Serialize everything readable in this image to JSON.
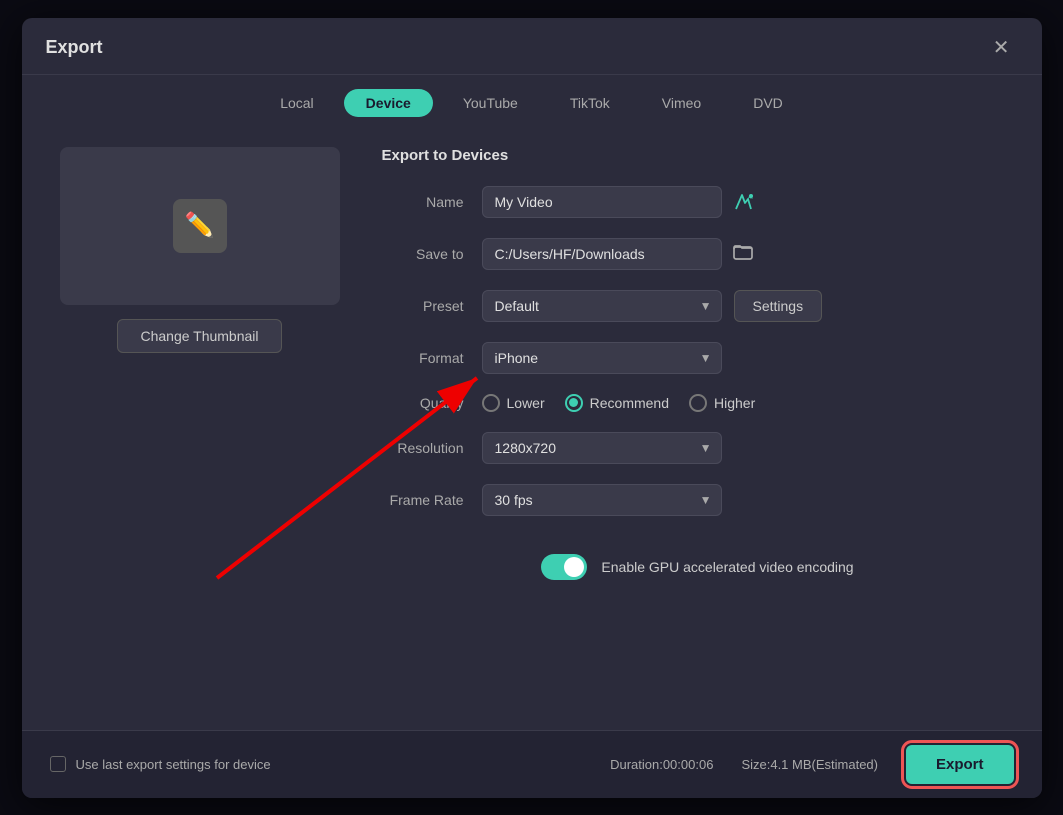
{
  "dialog": {
    "title": "Export",
    "close_label": "✕"
  },
  "tabs": [
    {
      "id": "local",
      "label": "Local",
      "active": false
    },
    {
      "id": "device",
      "label": "Device",
      "active": true
    },
    {
      "id": "youtube",
      "label": "YouTube",
      "active": false
    },
    {
      "id": "tiktok",
      "label": "TikTok",
      "active": false
    },
    {
      "id": "vimeo",
      "label": "Vimeo",
      "active": false
    },
    {
      "id": "dvd",
      "label": "DVD",
      "active": false
    }
  ],
  "section_title": "Export to Devices",
  "form": {
    "name_label": "Name",
    "name_value": "My Video",
    "save_to_label": "Save to",
    "save_to_value": "C:/Users/HF/Downloads",
    "preset_label": "Preset",
    "preset_value": "Default",
    "format_label": "Format",
    "format_value": "iPhone",
    "quality_label": "Quality",
    "quality_options": [
      {
        "id": "lower",
        "label": "Lower",
        "selected": false
      },
      {
        "id": "recommend",
        "label": "Recommend",
        "selected": true
      },
      {
        "id": "higher",
        "label": "Higher",
        "selected": false
      }
    ],
    "resolution_label": "Resolution",
    "resolution_value": "1280x720",
    "frame_rate_label": "Frame Rate",
    "frame_rate_value": "30 fps"
  },
  "gpu_label": "Enable GPU accelerated video encoding",
  "settings_btn_label": "Settings",
  "change_thumbnail_label": "Change Thumbnail",
  "footer": {
    "last_export_label": "Use last export settings for device",
    "duration_label": "Duration:00:00:06",
    "size_label": "Size:4.1 MB(Estimated)",
    "export_label": "Export"
  }
}
